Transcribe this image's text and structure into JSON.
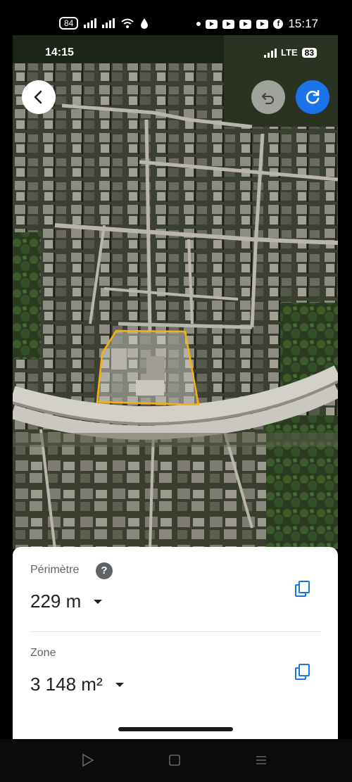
{
  "outer_status": {
    "battery": "84",
    "time": "15:17",
    "app_icons": [
      "youtube-icon",
      "youtube-icon",
      "youtube-icon",
      "youtube-icon",
      "facebook-icon"
    ]
  },
  "inner_status": {
    "time": "14:15",
    "network": "LTE",
    "battery": "83"
  },
  "map": {
    "type": "satellite",
    "selection_color": "#f6b10a",
    "selection_label": ""
  },
  "controls": {
    "back": "back-arrow-icon",
    "undo": "undo-icon",
    "redo": "redo-icon"
  },
  "measurements": {
    "perimeter_label": "Périmètre",
    "perimeter_value": "229 m",
    "help": "?",
    "area_label": "Zone",
    "area_value": "3 148 m²"
  },
  "colors": {
    "accent": "#1a73e8",
    "polygon": "#f6b10a"
  }
}
